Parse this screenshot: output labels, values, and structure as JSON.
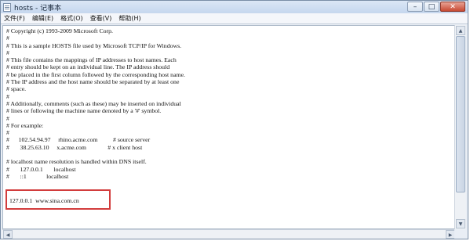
{
  "window": {
    "title": "hosts - 记事本",
    "controls": {
      "minimize": "–",
      "maximize": "□",
      "close": "✕"
    }
  },
  "menu": [
    "文件(F)",
    "编辑(E)",
    "格式(O)",
    "查看(V)",
    "帮助(H)"
  ],
  "editor": {
    "lines": [
      "# Copyright (c) 1993-2009 Microsoft Corp.",
      "#",
      "# This is a sample HOSTS file used by Microsoft TCP/IP for Windows.",
      "#",
      "# This file contains the mappings of IP addresses to host names. Each",
      "# entry should be kept on an individual line. The IP address should",
      "# be placed in the first column followed by the corresponding host name.",
      "# The IP address and the host name should be separated by at least one",
      "# space.",
      "#",
      "# Additionally, comments (such as these) may be inserted on individual",
      "# lines or following the machine name denoted by a '#' symbol.",
      "#",
      "# For example:",
      "#",
      "#      102.54.94.97     rhino.acme.com          # source server",
      "#       38.25.63.10     x.acme.com              # x client host",
      "",
      "# localhost name resolution is handled within DNS itself.",
      "#       127.0.0.1       localhost",
      "#       ::1             localhost",
      "",
      ""
    ],
    "highlighted_line": "127.0.0.1  www.sina.com.cn"
  },
  "colors": {
    "highlight_border": "#d23c3c",
    "close_button": "#c84a33"
  }
}
